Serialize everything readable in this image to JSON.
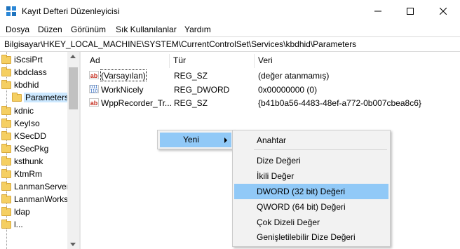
{
  "window": {
    "title": "Kayıt Defteri Düzenleyicisi",
    "icon": "regedit-icon"
  },
  "menu": {
    "items": [
      "Dosya",
      "Düzen",
      "Görünüm",
      "Sık Kullanılanlar",
      "Yardım"
    ]
  },
  "address": {
    "path": "Bilgisayar\\HKEY_LOCAL_MACHINE\\SYSTEM\\CurrentControlSet\\Services\\kbdhid\\Parameters"
  },
  "tree": {
    "items": [
      {
        "label": "iScsiPrt"
      },
      {
        "label": "kbdclass"
      },
      {
        "label": "kbdhid"
      },
      {
        "label": "Parameters",
        "selected": true
      },
      {
        "label": "kdnic"
      },
      {
        "label": "KeyIso"
      },
      {
        "label": "KSecDD"
      },
      {
        "label": "KSecPkg"
      },
      {
        "label": "ksthunk"
      },
      {
        "label": "KtmRm"
      },
      {
        "label": "LanmanServer"
      },
      {
        "label": "LanmanWorks"
      },
      {
        "label": "ldap"
      },
      {
        "label": "l..."
      }
    ]
  },
  "list": {
    "columns": [
      "Ad",
      "Tür",
      "Veri"
    ],
    "rows": [
      {
        "name": "(Varsayılan)",
        "type": "REG_SZ",
        "data": "(değer atanmamış)",
        "icon": "string-value-icon"
      },
      {
        "name": "WorkNicely",
        "type": "REG_DWORD",
        "data": "0x00000000 (0)",
        "icon": "binary-value-icon"
      },
      {
        "name": "WppRecorder_Tr...",
        "type": "REG_SZ",
        "data": "{b41b0a56-4483-48ef-a772-0b007cbea8c6}",
        "icon": "string-value-icon"
      }
    ]
  },
  "context_menu": {
    "new_label": "Yeni",
    "submenu": [
      "Anahtar",
      "Dize Değeri",
      "İkili Değer",
      "DWORD (32 bit) Değeri",
      "QWORD (64 bit) Değeri",
      "Çok Dizeli Değer",
      "Genişletilebilir Dize Değeri"
    ],
    "highlighted": "DWORD (32 bit) Değeri"
  },
  "colors": {
    "highlight": "#91c9f7",
    "selection": "#cce8ff",
    "folder": "#f5cf62"
  }
}
